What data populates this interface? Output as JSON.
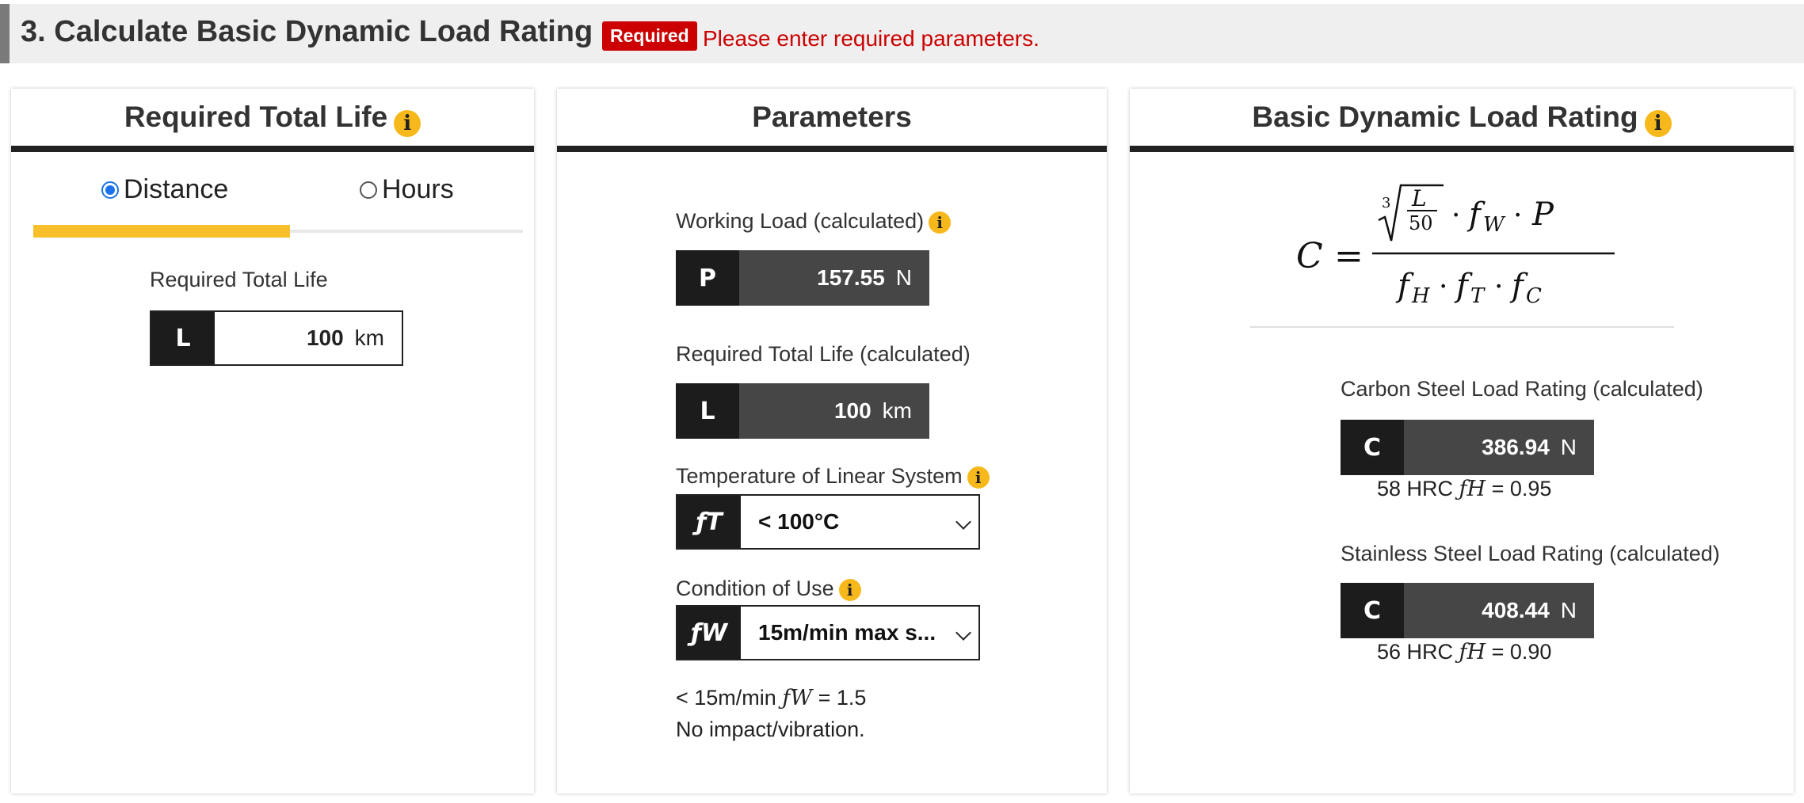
{
  "header": {
    "title": "3. Calculate Basic Dynamic Load Rating",
    "badge": "Required",
    "message": "Please enter required parameters."
  },
  "left_panel": {
    "title": "Required Total Life",
    "mode_options": [
      "Distance",
      "Hours"
    ],
    "selected_mode": "Distance",
    "field_label": "Required Total Life",
    "field_symbol": "L",
    "field_value": "100",
    "field_unit": "km"
  },
  "middle_panel": {
    "title": "Parameters",
    "working_load": {
      "label": "Working Load (calculated)",
      "symbol": "P",
      "value": "157.55",
      "unit": "N"
    },
    "total_life": {
      "label": "Required Total Life (calculated)",
      "symbol": "L",
      "value": "100",
      "unit": "km"
    },
    "temperature": {
      "label": "Temperature of Linear System",
      "symbol": "ƒT",
      "selected": "< 100°C"
    },
    "condition": {
      "label": "Condition of Use",
      "symbol": "ƒW",
      "selected": "15m/min max s...",
      "note_speed": "< 15m/min",
      "note_factor_symbol": "ƒW",
      "note_factor": "= 1.5",
      "note_impact": "No impact/vibration."
    }
  },
  "right_panel": {
    "title": "Basic Dynamic Load Rating",
    "carbon": {
      "label": "Carbon Steel Load Rating (calculated)",
      "symbol": "C",
      "value": "386.94",
      "unit": "N",
      "hardness": "58 HRC",
      "fh_symbol": "ƒH",
      "fh_value": "= 0.95"
    },
    "stainless": {
      "label": "Stainless Steel Load Rating (calculated)",
      "symbol": "C",
      "value": "408.44",
      "unit": "N",
      "hardness": "56 HRC",
      "fh_symbol": "ƒH",
      "fh_value": "= 0.90"
    }
  },
  "colors": {
    "accent": "#f7c02a",
    "required": "#cc0000",
    "dark": "#1c1c1c",
    "value_bg": "#464646",
    "radio": "#1a73e8"
  }
}
